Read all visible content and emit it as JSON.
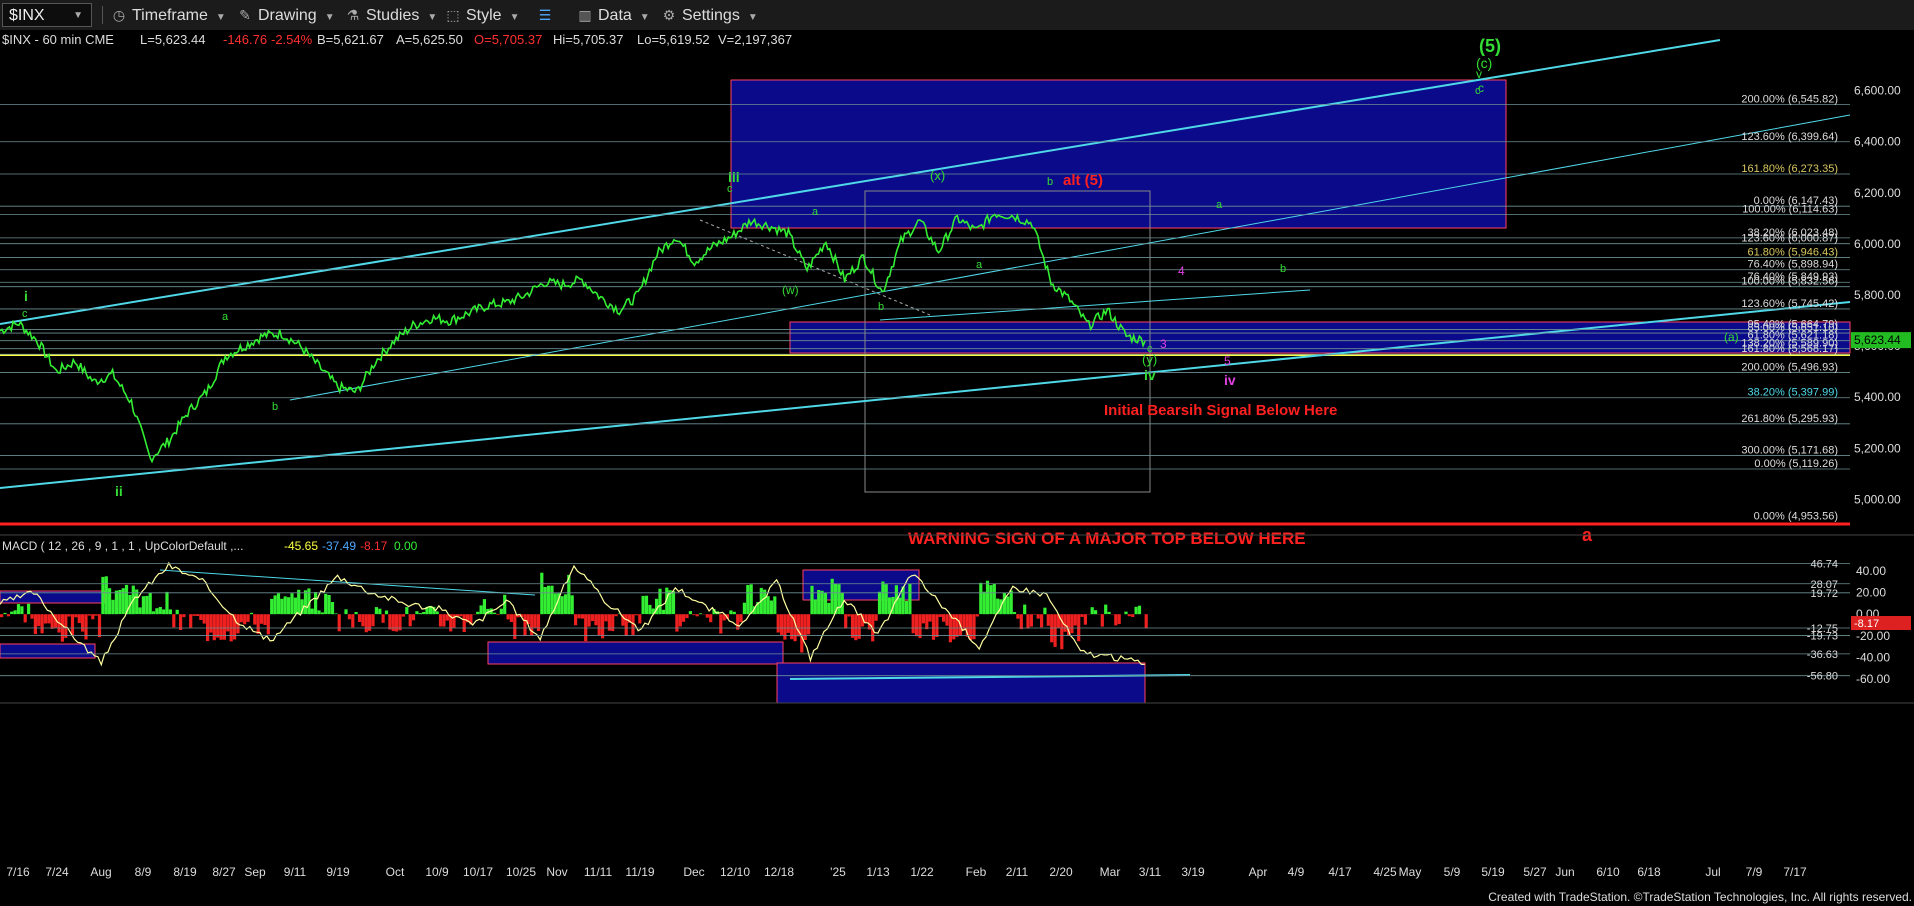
{
  "toolbar": {
    "symbol": "$INX",
    "timeframe": "Timeframe",
    "drawing": "Drawing",
    "studies": "Studies",
    "style": "Style",
    "data": "Data",
    "settings": "Settings"
  },
  "header": {
    "symbol_info": "$INX - 60 min  CME",
    "last": "L=5,623.44",
    "change": "-146.76",
    "change_pct": "-2.54%",
    "bid": "B=5,621.67",
    "ask": "A=5,625.50",
    "open": "O=5,705.37",
    "high": "Hi=5,705.37",
    "low": "Lo=5,619.52",
    "volume": "V=2,197,367"
  },
  "colors": {
    "background": "#000000",
    "price": "#33ee33",
    "channel": "#4fd8e8",
    "blue_box": "#0a0a8a",
    "red": "#ff2020",
    "yellow": "#ffff40",
    "magenta": "#e040e0",
    "green_label": "#33dd33"
  },
  "chart_data": [
    {
      "type": "line",
      "title": "$INX - 60 min",
      "ylim": [
        4900,
        6700
      ],
      "y_ticks": [
        "6,600.00",
        "6,400.00",
        "6,200.00",
        "6,000.00",
        "5,800.00",
        "5,600.00",
        "5,400.00",
        "5,200.00",
        "5,000.00"
      ],
      "last_price": "5,623.44",
      "x_ticks": [
        "7/16",
        "7/24",
        "Aug",
        "8/9",
        "8/19",
        "8/27",
        "Sep",
        "9/11",
        "9/19",
        "Oct",
        "10/9",
        "10/17",
        "10/25",
        "Nov",
        "11/11",
        "11/19",
        "Dec",
        "12/10",
        "12/18",
        "'25",
        "1/13",
        "1/22",
        "Feb",
        "2/11",
        "2/20",
        "Mar",
        "3/11",
        "3/19",
        "Apr",
        "4/9",
        "4/17",
        "4/25",
        "May",
        "5/9",
        "5/19",
        "5/27",
        "Jun",
        "6/10",
        "6/18",
        "Jul",
        "7/9",
        "7/17"
      ],
      "series": [
        {
          "values": [
            5660,
            5690,
            5620,
            5500,
            5540,
            5460,
            5490,
            5380,
            5160,
            5230,
            5340,
            5420,
            5560,
            5600,
            5640,
            5650,
            5600,
            5520,
            5440,
            5420,
            5540,
            5620,
            5680,
            5710,
            5700,
            5730,
            5760,
            5770,
            5800,
            5850,
            5840,
            5860,
            5790,
            5740,
            5800,
            5960,
            6030,
            5930,
            5990,
            6030,
            6090,
            6070,
            6040,
            5900,
            6010,
            5860,
            5950,
            5810,
            6010,
            6090,
            5970,
            6100,
            6050,
            6120,
            6110,
            6080,
            5850,
            5780,
            5680,
            5740,
            5640,
            5620
          ]
        }
      ],
      "fib_labels": [
        {
          "text": "200.00% (6,545.82)",
          "value": 6545.82
        },
        {
          "text": "123.60% (6,399.64)",
          "value": 6399.64
        },
        {
          "text": "161.80% (6,273.35)",
          "value": 6273.35
        },
        {
          "text": "0.00% (6,147.43)",
          "value": 6147.43
        },
        {
          "text": "100.00% (6,114.63)",
          "value": 6114.63
        },
        {
          "text": "38.20% (6,023.48)",
          "value": 6023.48
        },
        {
          "text": "123.60% (6,000.87)",
          "value": 6000.87
        },
        {
          "text": "61.80% (5,946.43)",
          "value": 5946.43
        },
        {
          "text": "76.40% (5,898.94)",
          "value": 5898.94
        },
        {
          "text": "76.40% (5,849.93)",
          "value": 5849.93
        },
        {
          "text": "100.00% (5,832.56)",
          "value": 5832.56
        },
        {
          "text": "123.60% (5,745.42)",
          "value": 5745.42
        },
        {
          "text": "95.40% (5,664.79)",
          "value": 5664.79
        },
        {
          "text": "85.00% (5,651.10)",
          "value": 5651.1
        },
        {
          "text": "61.80% (5,621.18)",
          "value": 5621.18
        },
        {
          "text": "138.20% (5,589.90)",
          "value": 5589.9
        },
        {
          "text": "161.80% (5,568.17)",
          "value": 5568.17
        },
        {
          "text": "200.00% (5,496.93)",
          "value": 5496.93
        },
        {
          "text": "38.20% (5,397.99)",
          "value": 5397.99
        },
        {
          "text": "261.80% (5,295.93)",
          "value": 5295.93
        },
        {
          "text": "300.00% (5,171.68)",
          "value": 5171.68
        },
        {
          "text": "0.00% (5,119.26)",
          "value": 5119.26
        },
        {
          "text": "0.00% (4,953.56)",
          "value": 4953.56
        }
      ],
      "annotations": [
        {
          "text": "(5)",
          "color": "green"
        },
        {
          "text": "(c)",
          "color": "green"
        },
        {
          "text": "v",
          "color": "green"
        },
        {
          "text": "c",
          "color": "green"
        },
        {
          "text": "alt (5)",
          "color": "red"
        },
        {
          "text": "iii",
          "color": "green"
        },
        {
          "text": "(x)",
          "color": "green"
        },
        {
          "text": "(w)",
          "color": "green"
        },
        {
          "text": "(y)",
          "color": "green"
        },
        {
          "text": "iv",
          "color": "green"
        },
        {
          "text": "iv",
          "color": "magenta"
        },
        {
          "text": "i",
          "color": "green"
        },
        {
          "text": "ii",
          "color": "green"
        },
        {
          "text": "4",
          "color": "magenta"
        },
        {
          "text": "3",
          "color": "magenta"
        },
        {
          "text": "5",
          "color": "magenta"
        },
        {
          "text": "(a)",
          "color": "green"
        },
        {
          "text": "a",
          "color": "red"
        },
        {
          "text": "Initial Bearsih Signal Below Here",
          "color": "red"
        },
        {
          "text": "WARNING SIGN OF A MAJOR TOP BELOW HERE",
          "color": "red"
        }
      ]
    },
    {
      "type": "line",
      "title": "MACD ( 12 , 26 , 9 , 1 , 1 , UpColorDefault ,...",
      "readouts": [
        "-45.65",
        "-37.49",
        "-8.17",
        "0.00"
      ],
      "ylim": [
        -70,
        50
      ],
      "y_ticks": [
        "40.00",
        "20.00",
        "0.00",
        "-20.00",
        "-40.00",
        "-60.00"
      ],
      "level_labels": [
        "46.74",
        "28.07",
        "19.72",
        "-12.75",
        "-19.73",
        "-36.63",
        "-56.80"
      ],
      "last_value": "-8.17",
      "series": [
        {
          "name": "MACD",
          "values": [
            10,
            20,
            -15,
            -45,
            15,
            45,
            30,
            -5,
            -25,
            5,
            35,
            20,
            10,
            5,
            -10,
            12,
            -22,
            45,
            10,
            -15,
            25,
            5,
            -10,
            30,
            -40,
            15,
            -20,
            38,
            5,
            -30,
            25,
            18,
            -35,
            -40,
            -45
          ]
        }
      ]
    }
  ],
  "footer": {
    "credit": "Created with TradeStation. ©TradeStation Technologies, Inc. All rights reserved."
  }
}
